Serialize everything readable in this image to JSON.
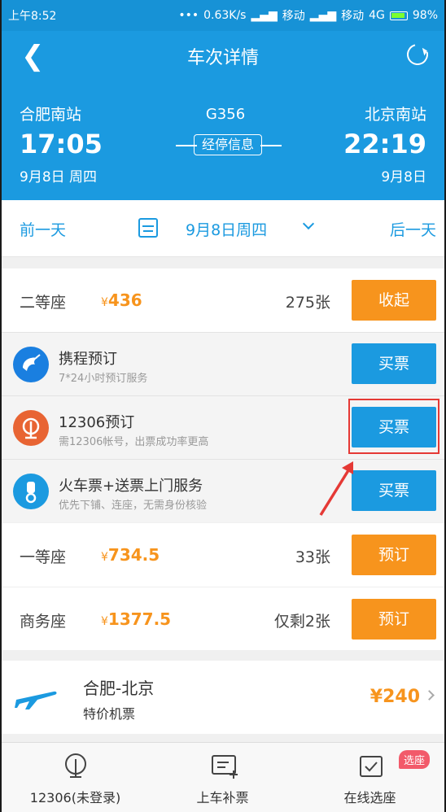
{
  "status": {
    "time": "上午8:52",
    "net_speed": "0.63K/s",
    "carrier1": "移动",
    "carrier2": "移动",
    "network": "4G",
    "battery": "98%"
  },
  "header": {
    "title": "车次详情"
  },
  "trip": {
    "from_station": "合肥南站",
    "depart_time": "17:05",
    "depart_date": "9月8日 周四",
    "train_no": "G356",
    "stops_label": "经停信息",
    "to_station": "北京南站",
    "arrive_time": "22:19",
    "arrive_date": "9月8日"
  },
  "daybar": {
    "prev": "前一天",
    "date": "9月8日周四",
    "next": "后一天"
  },
  "seats": [
    {
      "name": "二等座",
      "price": "436",
      "count": "275张",
      "action": "收起"
    },
    {
      "name": "一等座",
      "price": "734.5",
      "count": "33张",
      "action": "预订"
    },
    {
      "name": "商务座",
      "price": "1377.5",
      "count": "仅剩2张",
      "action": "预订"
    }
  ],
  "currency": "¥",
  "channels": [
    {
      "title": "携程预订",
      "desc": "7*24小时预订服务",
      "action": "买票",
      "color": "#1a7fe0"
    },
    {
      "title": "12306预订",
      "desc": "需12306帐号，出票成功率更高",
      "action": "买票",
      "color": "#e86433"
    },
    {
      "title": "火车票+送票上门服务",
      "desc": "优先下铺、连座，无需身份核验",
      "action": "买票",
      "color": "#1b9ae0"
    }
  ],
  "flight": {
    "route": "合肥-北京",
    "label": "特价机票",
    "price": "¥240"
  },
  "tabs": [
    {
      "label": "12306(未登录)"
    },
    {
      "label": "上车补票"
    },
    {
      "label": "在线选座",
      "badge": "选座"
    }
  ]
}
